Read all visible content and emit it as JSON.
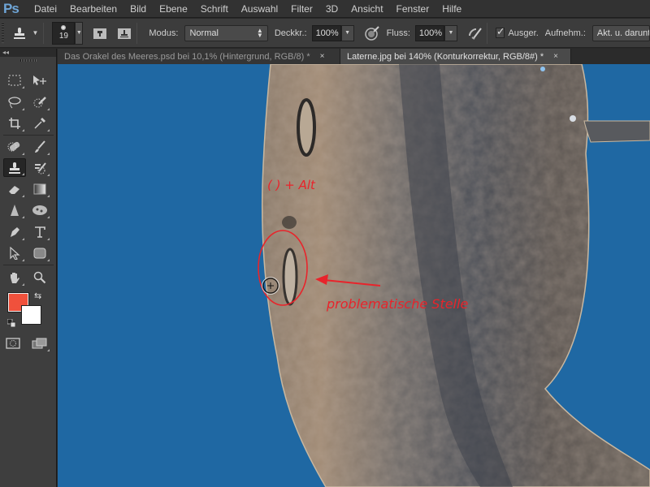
{
  "app": {
    "logo": "Ps",
    "name": "Adobe Photoshop"
  },
  "menu": [
    "Datei",
    "Bearbeiten",
    "Bild",
    "Ebene",
    "Schrift",
    "Auswahl",
    "Filter",
    "3D",
    "Ansicht",
    "Fenster",
    "Hilfe"
  ],
  "options": {
    "tool_icon": "clone-stamp-icon",
    "brush_size": "19",
    "mode_label": "Modus:",
    "mode_value": "Normal",
    "opacity_label": "Deckkr.:",
    "opacity_value": "100%",
    "flow_label": "Fluss:",
    "flow_value": "100%",
    "aligned_label": "Ausger.",
    "aligned_checked": true,
    "sample_label": "Aufnehm.:",
    "sample_value": "Akt. u. darunter"
  },
  "toolbox": {
    "collapse_label": "◂◂",
    "foreground_color": "#f0513c",
    "background_color": "#ffffff",
    "active_tool": "clone-stamp"
  },
  "tabs": [
    {
      "label": "Das Orakel des Meeres.psd bei 10,1% (Hintergrund, RGB/8) *",
      "close": "×",
      "active": false
    },
    {
      "label": "Laterne.jpg bei 140% (Konturkorrektur, RGB/8#) *",
      "close": "×",
      "active": true
    }
  ],
  "canvas": {
    "background_color": "#1f68a3",
    "annotation_shortcut": "(   ) + Alt",
    "annotation_problem": "problematische Stelle",
    "annotation_color": "#e8242b"
  }
}
